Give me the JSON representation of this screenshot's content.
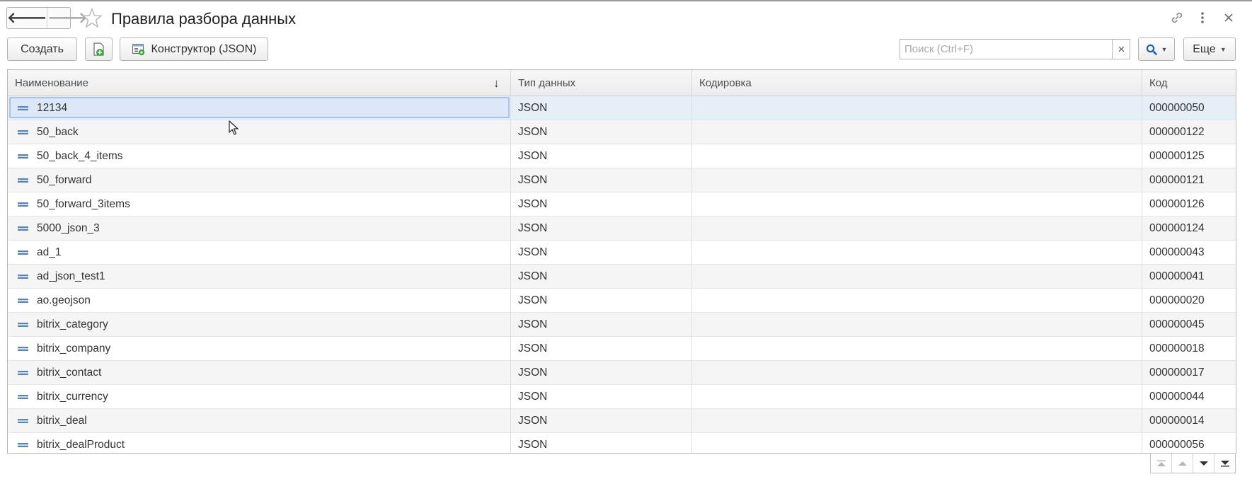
{
  "window": {
    "title": "Правила разбора данных"
  },
  "toolbar": {
    "create_label": "Создать",
    "constructor_label": "Конструктор (JSON)",
    "search_placeholder": "Поиск (Ctrl+F)",
    "search_clear": "×",
    "more_label": "Еще"
  },
  "table": {
    "columns": [
      {
        "label": "Наименование",
        "sort": "descending"
      },
      {
        "label": "Тип данных"
      },
      {
        "label": "Кодировка"
      },
      {
        "label": "Код"
      }
    ],
    "selected_row": 0,
    "rows": [
      {
        "name": "12134",
        "type": "JSON",
        "encoding": "",
        "code": "000000050"
      },
      {
        "name": "50_back",
        "type": "JSON",
        "encoding": "",
        "code": "000000122"
      },
      {
        "name": "50_back_4_items",
        "type": "JSON",
        "encoding": "",
        "code": "000000125"
      },
      {
        "name": "50_forward",
        "type": "JSON",
        "encoding": "",
        "code": "000000121"
      },
      {
        "name": "50_forward_3items",
        "type": "JSON",
        "encoding": "",
        "code": "000000126"
      },
      {
        "name": "5000_json_3",
        "type": "JSON",
        "encoding": "",
        "code": "000000124"
      },
      {
        "name": "ad_1",
        "type": "JSON",
        "encoding": "",
        "code": "000000043"
      },
      {
        "name": "ad_json_test1",
        "type": "JSON",
        "encoding": "",
        "code": "000000041"
      },
      {
        "name": "ao.geojson",
        "type": "JSON",
        "encoding": "",
        "code": "000000020"
      },
      {
        "name": "bitrix_category",
        "type": "JSON",
        "encoding": "",
        "code": "000000045"
      },
      {
        "name": "bitrix_company",
        "type": "JSON",
        "encoding": "",
        "code": "000000018"
      },
      {
        "name": "bitrix_contact",
        "type": "JSON",
        "encoding": "",
        "code": "000000017"
      },
      {
        "name": "bitrix_currency",
        "type": "JSON",
        "encoding": "",
        "code": "000000044"
      },
      {
        "name": "bitrix_deal",
        "type": "JSON",
        "encoding": "",
        "code": "000000014"
      },
      {
        "name": "bitrix_dealProduct",
        "type": "JSON",
        "encoding": "",
        "code": "000000056"
      }
    ]
  },
  "colors": {
    "selection": "#dce8f7",
    "row_icon": "#5a84b8",
    "search_icon": "#1f5fa8",
    "add_icon": "#3aa63a"
  },
  "icons": {
    "back": "arrow-left-icon",
    "forward": "arrow-right-icon",
    "favorite": "star-icon",
    "link": "link-icon",
    "menu": "more-vertical-icon",
    "close": "close-icon",
    "add_copy": "add-document-icon",
    "constructor": "constructor-icon",
    "search": "search-icon",
    "row": "catalog-item-icon"
  }
}
